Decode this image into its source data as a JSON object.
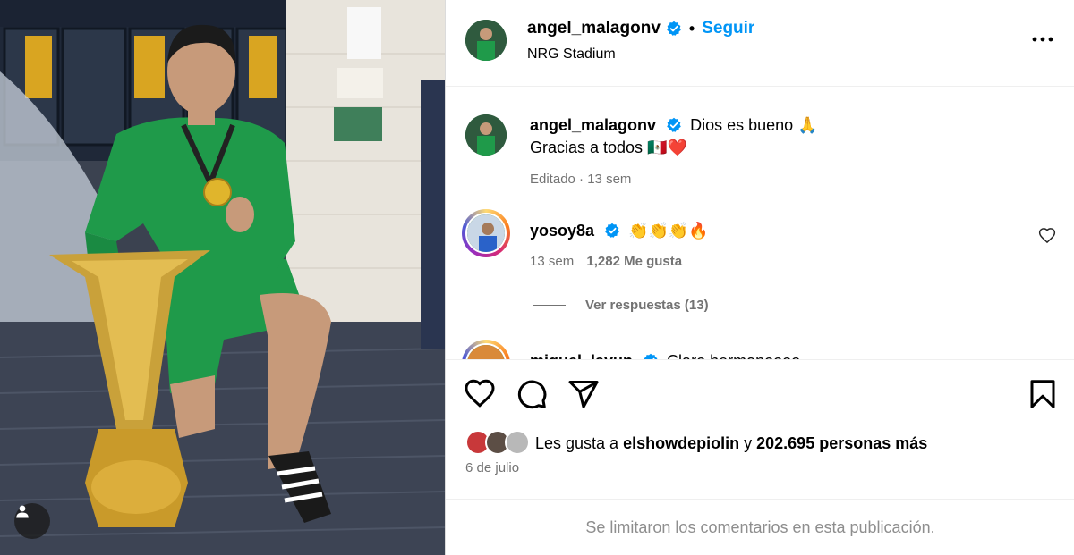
{
  "post": {
    "username": "angel_malagonv",
    "follow_label": "Seguir",
    "separator": "•",
    "location": "NRG Stadium"
  },
  "caption": {
    "username": "angel_malagonv",
    "line1": "Dios es bueno 🙏",
    "line2": "Gracias a todos 🇲🇽❤️",
    "edited": "Editado",
    "meta_sep": "·",
    "time": "13 sem"
  },
  "comments": [
    {
      "username": "yosoy8a",
      "text": "👏👏👏🔥",
      "time": "13 sem",
      "likes": "1,282 Me gusta",
      "replies": "Ver respuestas (13)"
    },
    {
      "username": "miguel_layun",
      "text": "Claro hermanoooo"
    }
  ],
  "likes": {
    "prefix": "Les gusta a",
    "user": "elshowdepiolin",
    "conj": "y",
    "others": "202.695 personas más"
  },
  "date": "6 de julio",
  "comments_limited": "Se limitaron los comentarios en esta publicación.",
  "colors": {
    "link_blue": "#0095f6",
    "muted": "#737373",
    "jersey_green": "#1f9a4a"
  },
  "icons": [
    "more-icon",
    "verified-icon",
    "heart-icon",
    "comment-icon",
    "share-icon",
    "bookmark-icon",
    "user-tag-icon"
  ]
}
